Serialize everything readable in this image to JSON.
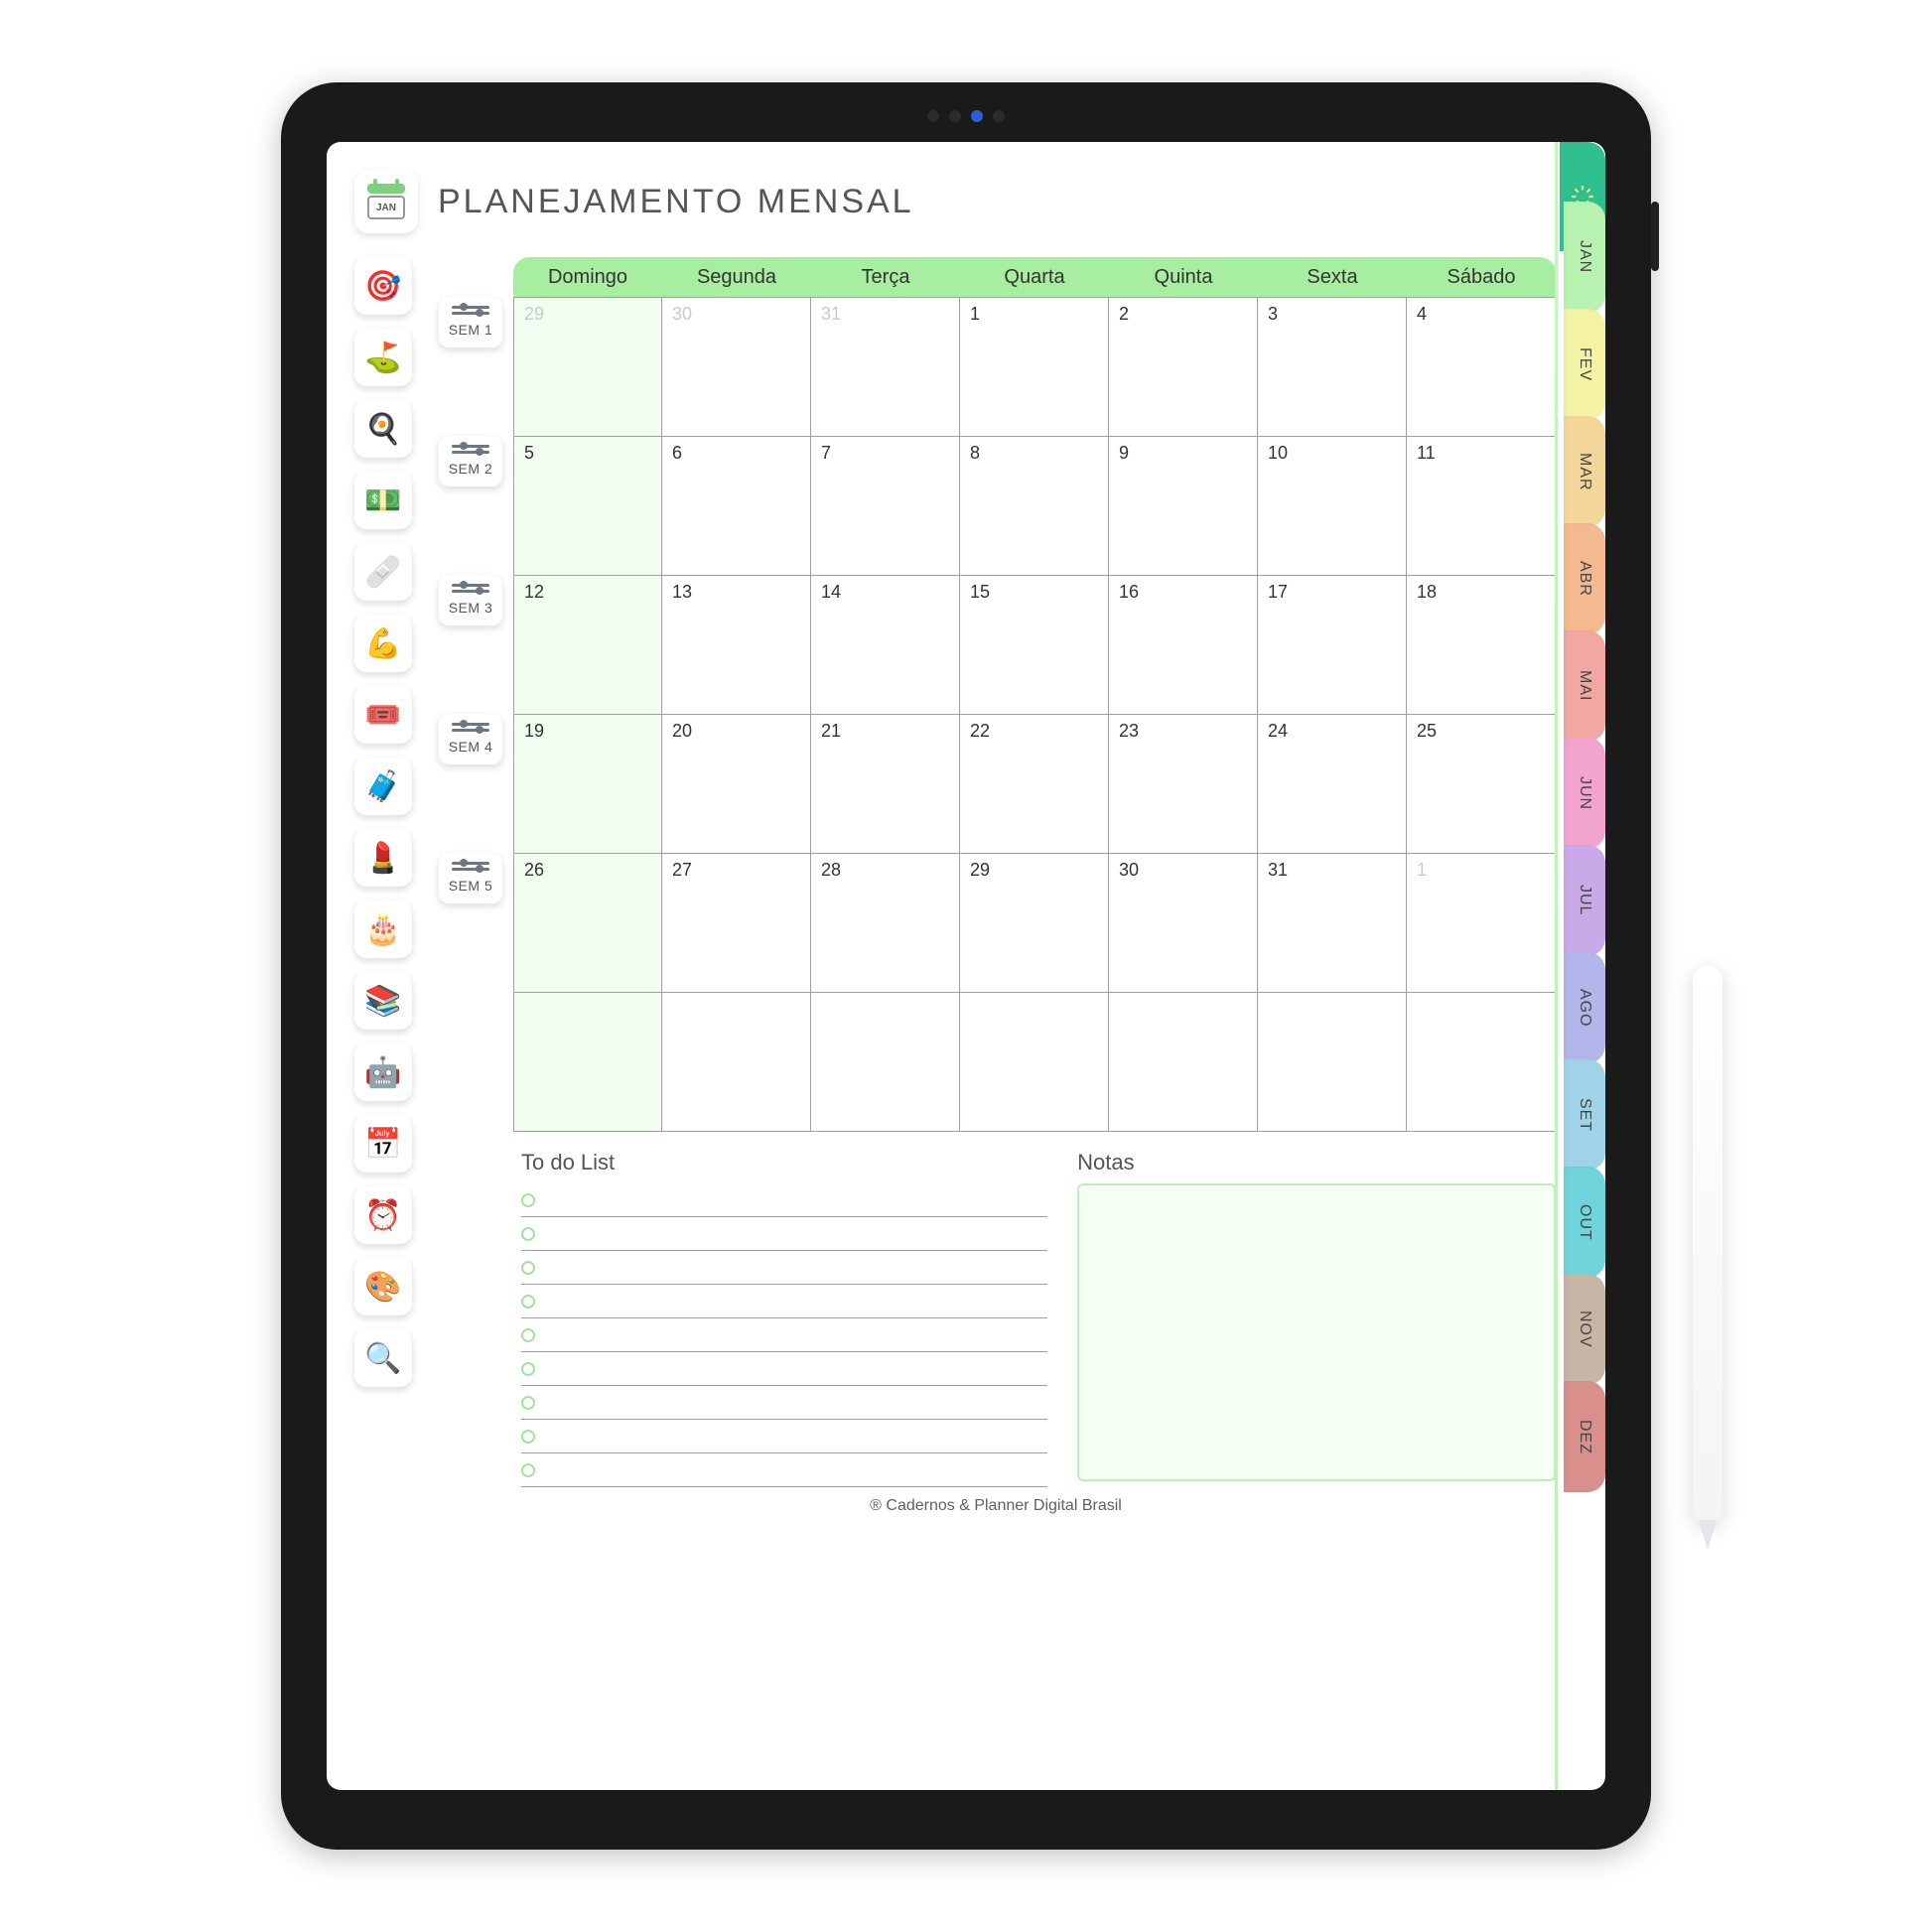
{
  "header": {
    "icon_month": "JAN",
    "title": "PLANEJAMENTO MENSAL"
  },
  "colors": {
    "accent_green": "#a8eea0",
    "top_tab": "#2fbf8f"
  },
  "sidebar_icons": [
    {
      "name": "target-icon",
      "glyph": "🎯"
    },
    {
      "name": "flag-route-icon",
      "glyph": "⛳"
    },
    {
      "name": "search-cook-icon",
      "glyph": "🍳"
    },
    {
      "name": "money-hand-icon",
      "glyph": "💵"
    },
    {
      "name": "medical-kit-icon",
      "glyph": "🩹"
    },
    {
      "name": "fitness-icon",
      "glyph": "💪"
    },
    {
      "name": "tickets-icon",
      "glyph": "🎟️"
    },
    {
      "name": "travel-icon",
      "glyph": "🧳"
    },
    {
      "name": "beauty-icon",
      "glyph": "💄"
    },
    {
      "name": "birthday-icon",
      "glyph": "🎂"
    },
    {
      "name": "books-icon",
      "glyph": "📚"
    },
    {
      "name": "robot-icon",
      "glyph": "🤖"
    },
    {
      "name": "calendar-heart-icon",
      "glyph": "📅"
    },
    {
      "name": "alarm-calendar-icon",
      "glyph": "⏰"
    },
    {
      "name": "color-wheel-icon",
      "glyph": "🎨"
    },
    {
      "name": "calendar-search-icon",
      "glyph": "🔍"
    }
  ],
  "weeks": [
    {
      "label": "SEM 1"
    },
    {
      "label": "SEM 2"
    },
    {
      "label": "SEM 3"
    },
    {
      "label": "SEM 4"
    },
    {
      "label": "SEM 5"
    }
  ],
  "days_of_week": [
    "Domingo",
    "Segunda",
    "Terça",
    "Quarta",
    "Quinta",
    "Sexta",
    "Sábado"
  ],
  "calendar_cells": [
    {
      "n": "29",
      "prev": true
    },
    {
      "n": "30",
      "prev": true
    },
    {
      "n": "31",
      "prev": true
    },
    {
      "n": "1"
    },
    {
      "n": "2"
    },
    {
      "n": "3"
    },
    {
      "n": "4"
    },
    {
      "n": "5"
    },
    {
      "n": "6"
    },
    {
      "n": "7"
    },
    {
      "n": "8"
    },
    {
      "n": "9"
    },
    {
      "n": "10"
    },
    {
      "n": "11"
    },
    {
      "n": "12"
    },
    {
      "n": "13"
    },
    {
      "n": "14"
    },
    {
      "n": "15"
    },
    {
      "n": "16"
    },
    {
      "n": "17"
    },
    {
      "n": "18"
    },
    {
      "n": "19"
    },
    {
      "n": "20"
    },
    {
      "n": "21"
    },
    {
      "n": "22"
    },
    {
      "n": "23"
    },
    {
      "n": "24"
    },
    {
      "n": "25"
    },
    {
      "n": "26"
    },
    {
      "n": "27"
    },
    {
      "n": "28"
    },
    {
      "n": "29"
    },
    {
      "n": "30"
    },
    {
      "n": "31"
    },
    {
      "n": "1",
      "next": true
    },
    {
      "n": ""
    },
    {
      "n": ""
    },
    {
      "n": ""
    },
    {
      "n": ""
    },
    {
      "n": ""
    },
    {
      "n": ""
    },
    {
      "n": ""
    }
  ],
  "month_tabs": [
    {
      "label": "JAN",
      "color": "#b8f2b1"
    },
    {
      "label": "FEV",
      "color": "#f4f2a3"
    },
    {
      "label": "MAR",
      "color": "#f3d79a"
    },
    {
      "label": "ABR",
      "color": "#f3b98f"
    },
    {
      "label": "MAI",
      "color": "#f2a7a3"
    },
    {
      "label": "JUN",
      "color": "#f2a4cf"
    },
    {
      "label": "JUL",
      "color": "#c9a9e8"
    },
    {
      "label": "AGO",
      "color": "#b2b6ea"
    },
    {
      "label": "SET",
      "color": "#9fd3e8"
    },
    {
      "label": "OUT",
      "color": "#6fd4dc"
    },
    {
      "label": "NOV",
      "color": "#c7b6a7"
    },
    {
      "label": "DEZ",
      "color": "#d98f8c"
    }
  ],
  "sections": {
    "todo_title": "To do List",
    "notes_title": "Notas"
  },
  "todo_lines": 9,
  "footer": "® Cadernos & Planner Digital Brasil"
}
